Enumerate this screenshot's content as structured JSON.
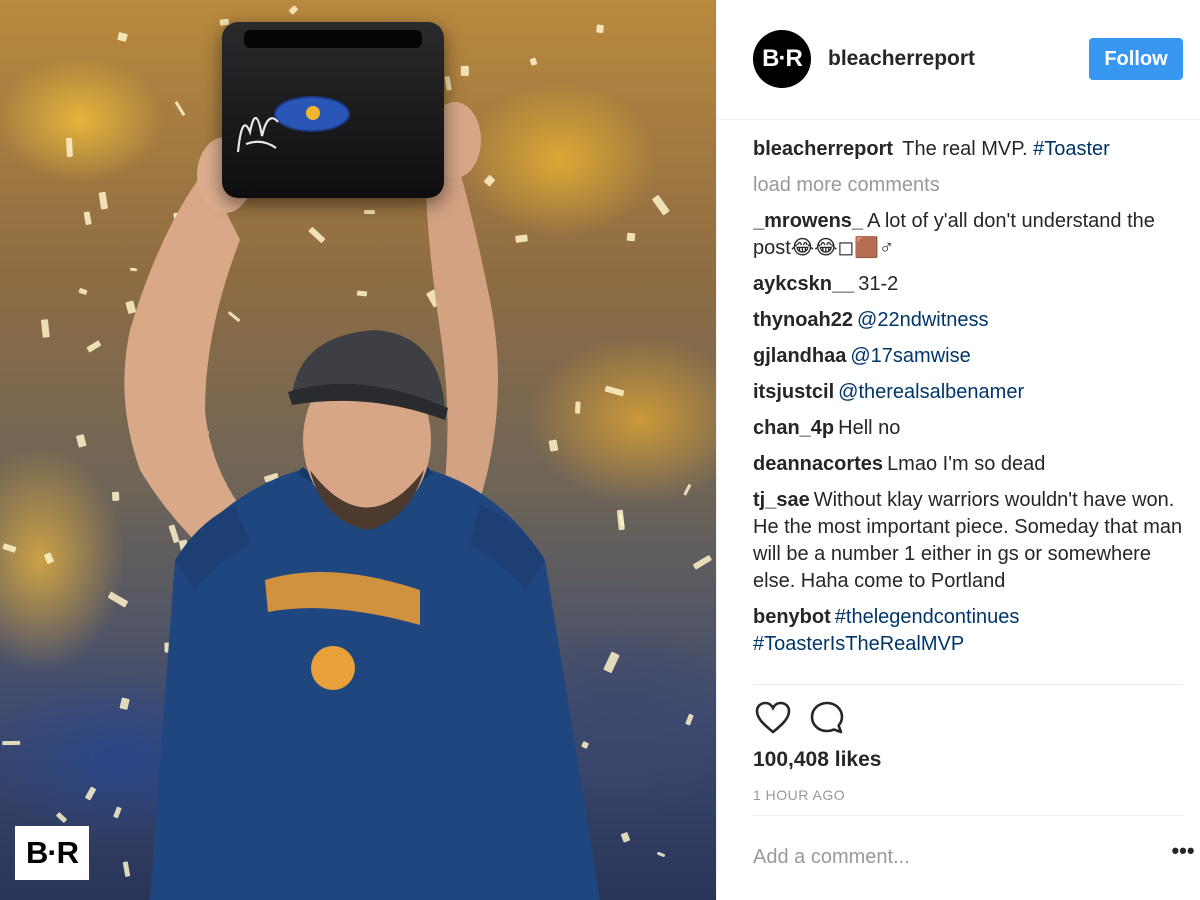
{
  "post": {
    "photo": {
      "badge_text": "B·R"
    },
    "header": {
      "avatar_text": "B·R",
      "username": "bleacherreport",
      "follow_label": "Follow"
    },
    "caption": {
      "user": "bleacherreport",
      "text": "The real MVP.",
      "tag": "#Toaster"
    },
    "load_more_label": "load more comments",
    "comments": [
      {
        "user": "_mrowens_",
        "text": "A lot of y'all don't understand the post😂😂◻🟫♂",
        "tag": ""
      },
      {
        "user": "aykcskn__",
        "text": "31-2",
        "tag": ""
      },
      {
        "user": "thynoah22",
        "text": "",
        "tag": "@22ndwitness"
      },
      {
        "user": "gjlandhaa",
        "text": "",
        "tag": "@17samwise"
      },
      {
        "user": "itsjustcil",
        "text": "",
        "tag": "@therealsalbenamer"
      },
      {
        "user": "chan_4p",
        "text": "Hell no",
        "tag": ""
      },
      {
        "user": "deannacortes",
        "text": "Lmao I'm so dead",
        "tag": ""
      },
      {
        "user": "tj_sae",
        "text": "Without klay warriors wouldn't have won. He the most important piece. Someday that man will be a number 1 either in gs or somewhere else. Haha come to Portland",
        "tag": ""
      },
      {
        "user": "benybot",
        "text": "",
        "tag": "#thelegendcontinues #ToasterIsTheRealMVP"
      }
    ],
    "actions": {
      "like_icon": "heart-icon",
      "comment_icon": "comment-icon"
    },
    "likes": "100,408 likes",
    "timestamp": "1 HOUR AGO",
    "add_comment": {
      "placeholder": "Add a comment...",
      "value": ""
    },
    "more_label": "•••",
    "colors": {
      "follow_blue": "#3897f0",
      "hashtag": "#003569",
      "muted": "#999999",
      "text": "#262626"
    }
  }
}
